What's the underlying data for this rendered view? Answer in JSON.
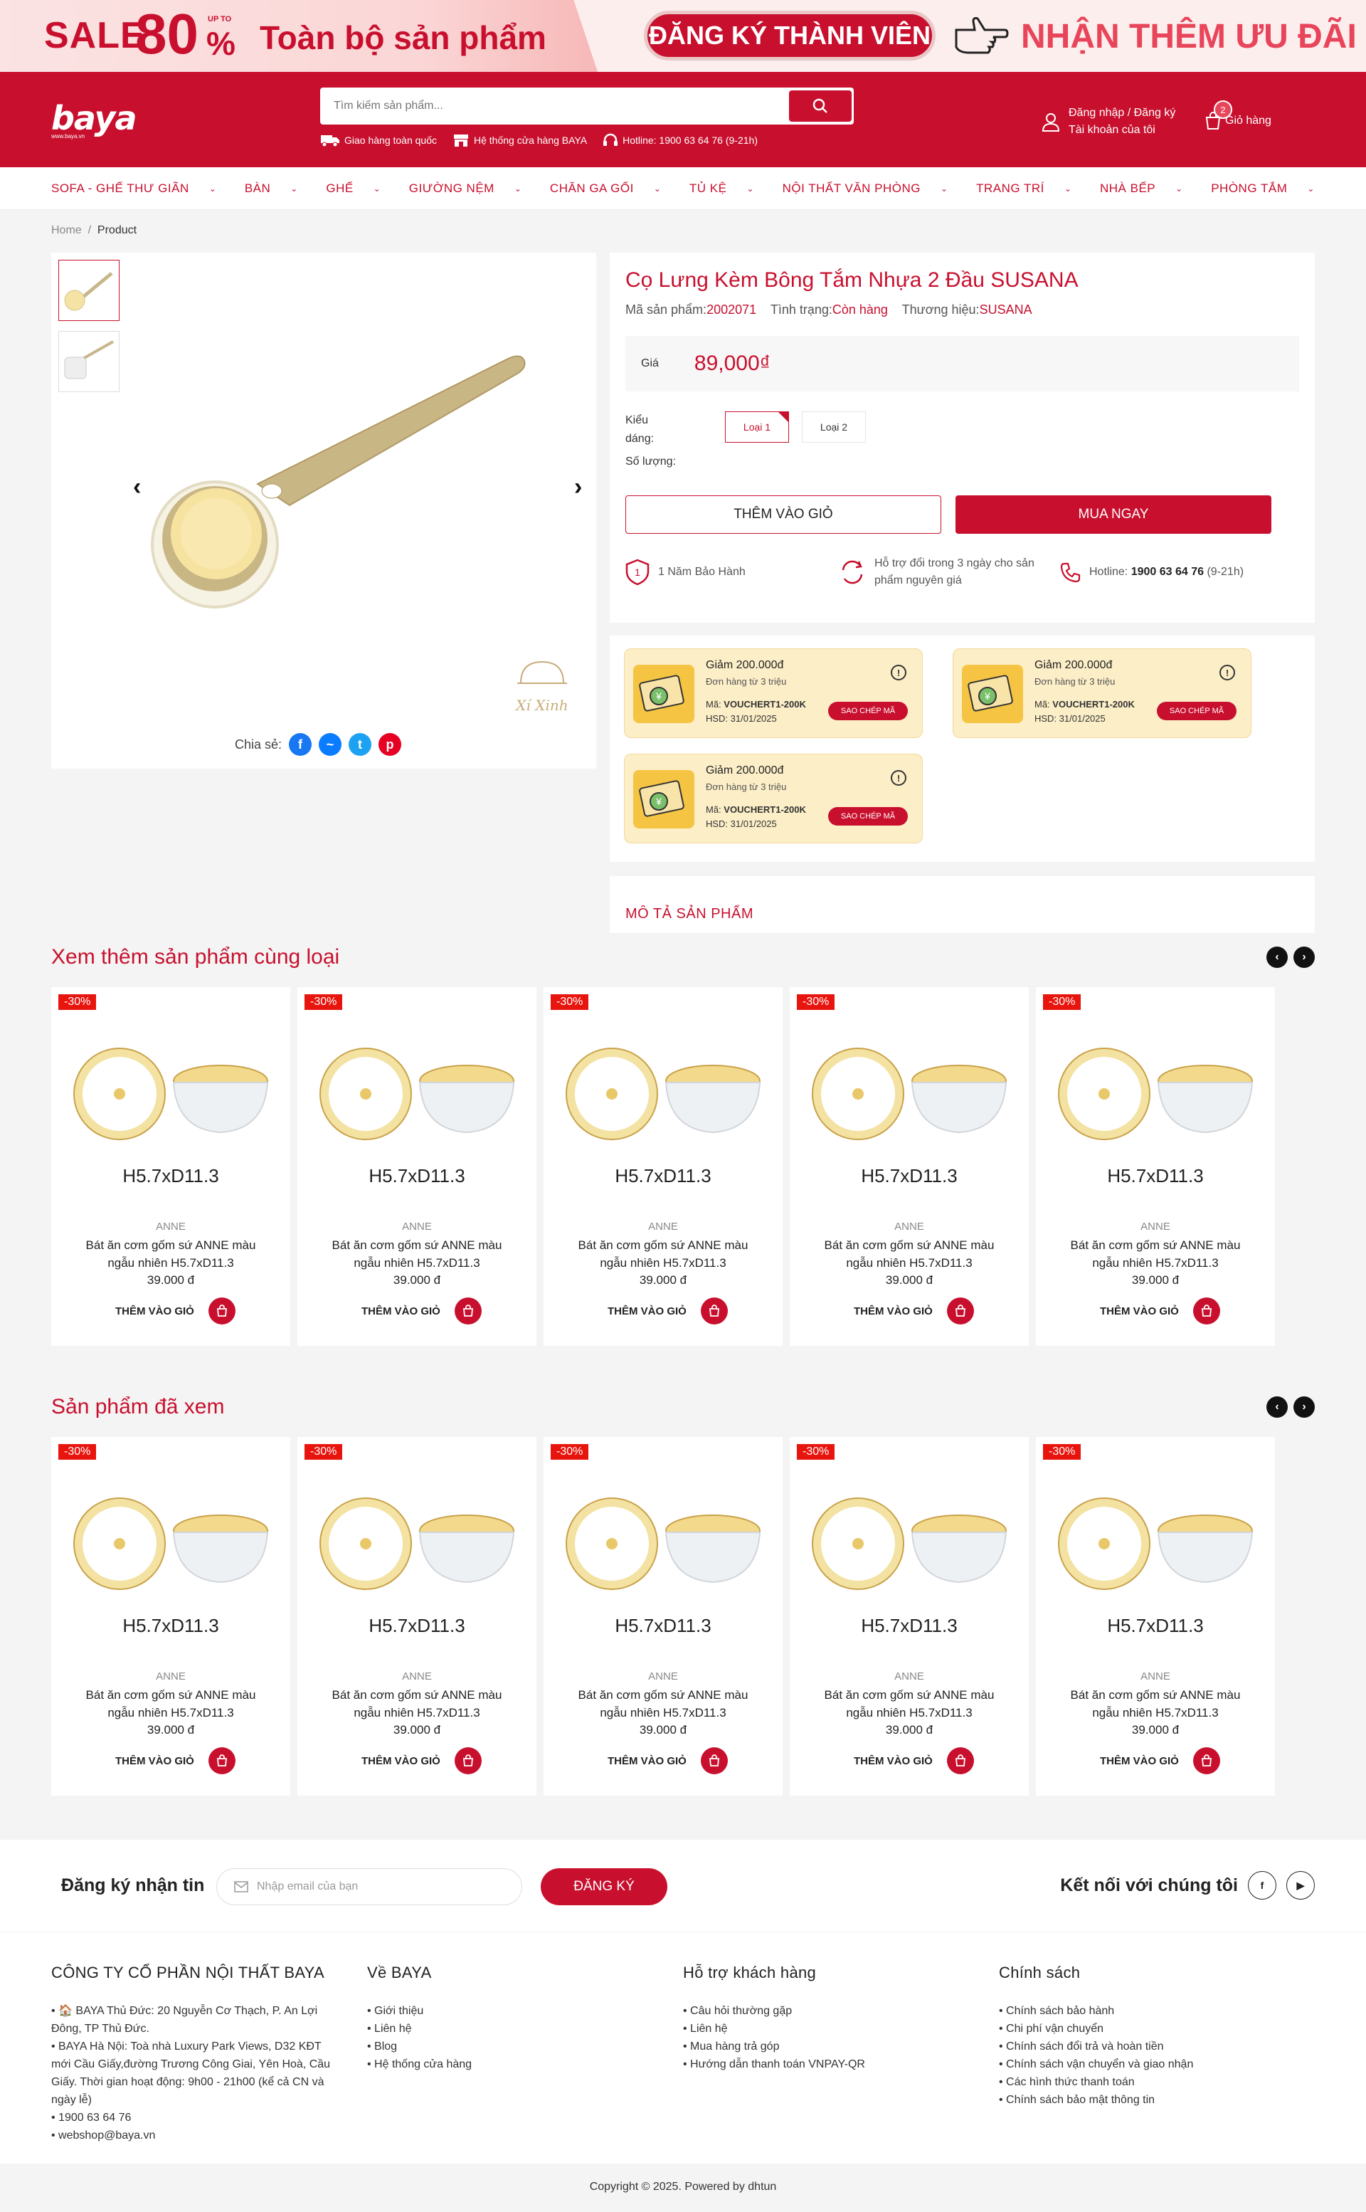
{
  "banner": {
    "sale": "SALE",
    "pct_num": "80",
    "pct_sym": "%",
    "upto": "UP TO",
    "all": "Toàn bộ sản phẩm",
    "register": "ĐĂNG KÝ THÀNH VIÊN",
    "more": "NHẬN THÊM ƯU ĐÃI"
  },
  "header": {
    "logo": "baya",
    "logo_sub": "www.baya.vn",
    "search_placeholder": "Tìm kiếm sản phẩm...",
    "shipping": "Giao hàng toàn quốc",
    "stores": "Hệ thống cửa hàng BAYA",
    "hotline": "Hotline: 1900 63 64 76 (9-21h)",
    "login": "Đăng nhập / Đăng ký",
    "account": "Tài khoản của tôi",
    "cart": "Giỏ hàng",
    "cart_count": "2"
  },
  "nav": [
    "SOFA - GHẾ THƯ GIÃN",
    "BÀN",
    "GHẾ",
    "GIƯỜNG NỆM",
    "CHĂN GA GỐI",
    "TỦ KỆ",
    "NỘI THẤT VĂN PHÒNG",
    "TRANG TRÍ",
    "NHÀ BẾP",
    "PHÒNG TẮM"
  ],
  "breadcrumb": {
    "home": "Home",
    "sep": "/",
    "current": "Product"
  },
  "product": {
    "title": "Cọ Lưng Kèm Bông Tắm Nhựa 2 Đầu SUSANA",
    "sku_label": "Mã sản phẩm:",
    "sku": "2002071",
    "status_label": "Tình trạng:",
    "status": "Còn hàng",
    "brand_label": "Thương hiệu:",
    "brand": "SUSANA",
    "price_label": "Giá",
    "price": "89,000₫",
    "variant_label": "Kiểu dáng:",
    "variants": [
      "Loại 1",
      "Loại 2"
    ],
    "qty_label": "Số lượng:",
    "add_cart": "THÊM VÀO GIỎ",
    "buy_now": "MUA NGAY",
    "perk_warranty": "1 Năm Bảo Hành",
    "perk_return": "Hỗ trợ đổi trong 3 ngày cho sản phẩm nguyên giá",
    "perk_hotline_prefix": "Hotline: ",
    "perk_hotline_num": "1900 63 64 76",
    "perk_hotline_hours": " (9-21h)",
    "share_label": "Chia sẻ:",
    "watermark": "Xí Xinh",
    "description_title": "MÔ TẢ SẢN PHẨM"
  },
  "vouchers": [
    {
      "title": "Giảm 200.000đ",
      "sub": "Đơn hàng từ 3 triệu",
      "code_label": "Mã: ",
      "code": "VOUCHERT1-200K",
      "exp": "HSD: 31/01/2025",
      "btn": "SAO CHÉP MÃ"
    },
    {
      "title": "Giảm 200.000đ",
      "sub": "Đơn hàng từ 3 triệu",
      "code_label": "Mã: ",
      "code": "VOUCHERT1-200K",
      "exp": "HSD: 31/01/2025",
      "btn": "SAO CHÉP MÃ"
    },
    {
      "title": "Giảm 200.000đ",
      "sub": "Đơn hàng từ 3 triệu",
      "code_label": "Mã: ",
      "code": "VOUCHERT1-200K",
      "exp": "HSD: 31/01/2025",
      "btn": "SAO CHÉP MÃ"
    }
  ],
  "related": {
    "title": "Xem thêm sản phẩm cùng loại",
    "items": [
      {
        "sale": "-30%",
        "dim": "H5.7xD11.3",
        "brand": "ANNE",
        "name": "Bát ăn cơm gốm sứ ANNE màu ngẫu nhiên H5.7xD11.3",
        "price": "39.000 đ",
        "add": "THÊM VÀO GIỎ"
      },
      {
        "sale": "-30%",
        "dim": "H5.7xD11.3",
        "brand": "ANNE",
        "name": "Bát ăn cơm gốm sứ ANNE màu ngẫu nhiên H5.7xD11.3",
        "price": "39.000 đ",
        "add": "THÊM VÀO GIỎ"
      },
      {
        "sale": "-30%",
        "dim": "H5.7xD11.3",
        "brand": "ANNE",
        "name": "Bát ăn cơm gốm sứ ANNE màu ngẫu nhiên H5.7xD11.3",
        "price": "39.000 đ",
        "add": "THÊM VÀO GIỎ"
      },
      {
        "sale": "-30%",
        "dim": "H5.7xD11.3",
        "brand": "ANNE",
        "name": "Bát ăn cơm gốm sứ ANNE màu ngẫu nhiên H5.7xD11.3",
        "price": "39.000 đ",
        "add": "THÊM VÀO GIỎ"
      },
      {
        "sale": "-30%",
        "dim": "H5.7xD11.3",
        "brand": "ANNE",
        "name": "Bát ăn cơm gốm sứ ANNE màu ngẫu nhiên H5.7xD11.3",
        "price": "39.000 đ",
        "add": "THÊM VÀO GIỎ"
      }
    ]
  },
  "viewed": {
    "title": "Sản phẩm đã xem",
    "items": [
      {
        "sale": "-30%",
        "dim": "H5.7xD11.3",
        "brand": "ANNE",
        "name": "Bát ăn cơm gốm sứ ANNE màu ngẫu nhiên H5.7xD11.3",
        "price": "39.000 đ",
        "add": "THÊM VÀO GIỎ"
      },
      {
        "sale": "-30%",
        "dim": "H5.7xD11.3",
        "brand": "ANNE",
        "name": "Bát ăn cơm gốm sứ ANNE màu ngẫu nhiên H5.7xD11.3",
        "price": "39.000 đ",
        "add": "THÊM VÀO GIỎ"
      },
      {
        "sale": "-30%",
        "dim": "H5.7xD11.3",
        "brand": "ANNE",
        "name": "Bát ăn cơm gốm sứ ANNE màu ngẫu nhiên H5.7xD11.3",
        "price": "39.000 đ",
        "add": "THÊM VÀO GIỎ"
      },
      {
        "sale": "-30%",
        "dim": "H5.7xD11.3",
        "brand": "ANNE",
        "name": "Bát ăn cơm gốm sứ ANNE màu ngẫu nhiên H5.7xD11.3",
        "price": "39.000 đ",
        "add": "THÊM VÀO GIỎ"
      },
      {
        "sale": "-30%",
        "dim": "H5.7xD11.3",
        "brand": "ANNE",
        "name": "Bát ăn cơm gốm sứ ANNE màu ngẫu nhiên H5.7xD11.3",
        "price": "39.000 đ",
        "add": "THÊM VÀO GIỎ"
      }
    ]
  },
  "newsletter": {
    "title": "Đăng ký nhận tin",
    "placeholder": "Nhập email của bạn",
    "button": "ĐĂNG KÝ",
    "connect": "Kết nối với chúng tôi",
    "fb": "f",
    "yt": "▶"
  },
  "footer": {
    "company": {
      "title": "CÔNG TY CỔ PHẦN NỘI THẤT BAYA",
      "lines": [
        "• 🏠 BAYA Thủ Đức: 20 Nguyễn Cơ Thạch, P. An Lợi Đông, TP Thủ Đức.",
        "• BAYA Hà Nội: Toà nhà Luxury Park Views, D32 KĐT mới Cầu Giấy,đường Trương Công Giai, Yên Hoà, Cầu Giấy. Thời gian hoạt động: 9h00 - 21h00 (kể cả CN và ngày lễ)",
        "• 1900 63 64 76",
        "• webshop@baya.vn"
      ]
    },
    "about": {
      "title": "Về BAYA",
      "links": [
        "Giới thiệu",
        "Liên hệ",
        "Blog",
        "Hệ thống cửa hàng"
      ]
    },
    "support": {
      "title": "Hỗ trợ khách hàng",
      "links": [
        "Câu hỏi thường gặp",
        "Liên hệ",
        "Mua hàng trả góp",
        "Hướng dẫn thanh toán VNPAY-QR"
      ]
    },
    "policy": {
      "title": "Chính sách",
      "links": [
        "Chính sách bảo hành",
        "Chi phí vận chuyển",
        "Chính sách đổi trả và hoàn tiền",
        "Chính sách vận chuyển và giao nhận",
        "Các hình thức thanh toán",
        "Chính sách bảo mật thông tin"
      ]
    },
    "copyright": "Copyright © 2025. Powered by dhtun"
  },
  "colors": {
    "brand": "#c8102e",
    "voucher_bg": "#fceec7",
    "sale_badge": "#e8150e"
  }
}
